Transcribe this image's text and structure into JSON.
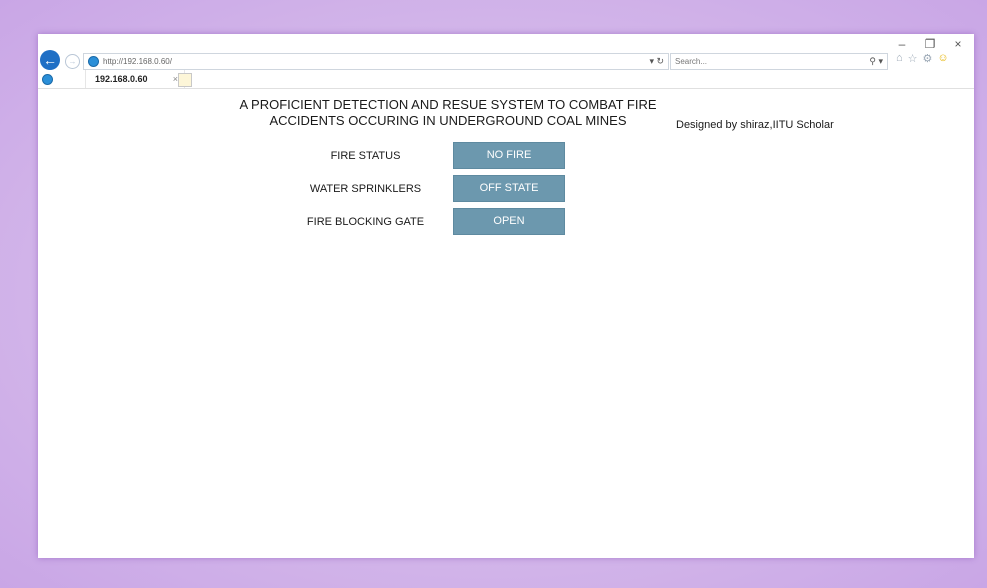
{
  "browser": {
    "url": "http://192.168.0.60/",
    "search_placeholder": "Search...",
    "tab_title": "192.168.0.60",
    "tab_close": "×",
    "controls": {
      "minimize": "–",
      "restore": "❐",
      "close": "×"
    }
  },
  "page": {
    "title_line1": "A PROFICIENT DETECTION AND RESUE SYSTEM TO COMBAT FIRE",
    "title_line2": "ACCIDENTS OCCURING IN UNDERGROUND COAL MINES",
    "credit": "Designed by shiraz,IITU Scholar",
    "status_rows": [
      {
        "label": "FIRE STATUS",
        "value": "NO FIRE"
      },
      {
        "label": "WATER SPRINKLERS",
        "value": "OFF STATE"
      },
      {
        "label": "FIRE BLOCKING GATE",
        "value": "OPEN"
      }
    ],
    "status_color": "#6c98ae"
  }
}
